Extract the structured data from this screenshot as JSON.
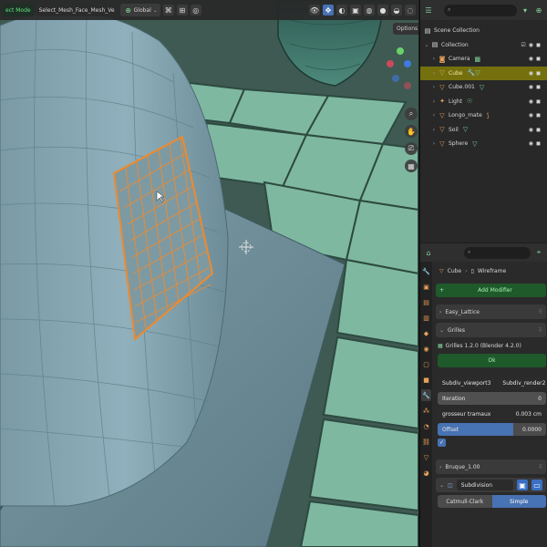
{
  "viewport": {
    "header": {
      "mode_label": "ect Mode",
      "menus": [
        "Select",
        "Mesh",
        "Face",
        "Mesh",
        "Ve"
      ],
      "menu_text": "Select_Mesh_Face_Mesh_Ve",
      "transform_label": "Global",
      "options_label": "Options"
    },
    "icons": {
      "gizmo": "axis-gizmo-icon",
      "zoom": "zoom-icon",
      "pan": "hand-icon",
      "camera": "camera-icon",
      "grid": "grid-icon"
    }
  },
  "outliner": {
    "search_placeholder": "",
    "items": [
      {
        "label": "Scene Collection",
        "icon": "scene-collection-icon",
        "indent": 0,
        "selected": false
      },
      {
        "label": "Collection",
        "icon": "collection-icon",
        "indent": 1,
        "selected": false
      },
      {
        "label": "Camera",
        "icon": "camera-object-icon",
        "indent": 2,
        "selected": false
      },
      {
        "label": "Cube",
        "icon": "mesh-object-icon",
        "indent": 2,
        "selected": true
      },
      {
        "label": "Cube.001",
        "icon": "mesh-object-icon",
        "indent": 2,
        "selected": false
      },
      {
        "label": "Light",
        "icon": "light-object-icon",
        "indent": 2,
        "selected": false
      },
      {
        "label": "Longo_mate",
        "icon": "mesh-object-icon",
        "indent": 2,
        "selected": false
      },
      {
        "label": "Soil",
        "icon": "mesh-object-icon",
        "indent": 2,
        "selected": false
      },
      {
        "label": "Sphere",
        "icon": "mesh-object-icon",
        "indent": 2,
        "selected": false
      }
    ]
  },
  "properties": {
    "breadcrumb": {
      "object": "Cube",
      "modifier": "Wireframe"
    },
    "add_modifier_label": "Add Modifier",
    "panels": {
      "first": "Easy_Lattice",
      "grilles": "Grilles",
      "last": "Bruque_1.00"
    },
    "grilles": {
      "node_label": "Grilles 1.2.0 (Blender 4.2.0)",
      "ok_label": "Ok",
      "subdiv_viewport_label": "Subdiv_viewport",
      "subdiv_viewport_value": "3",
      "subdiv_render_label": "Subdiv_render",
      "subdiv_render_value": "2",
      "iteration_label": "Iteration",
      "iteration_value": "0",
      "thickness_label": "grosseur tramaux",
      "thickness_value": "0.003 cm",
      "offset_label": "Offset",
      "offset_value": "0.0000",
      "offset_fraction": 0.7
    },
    "subdivision": {
      "label": "Subdivision",
      "option_left": "Catmull-Clark",
      "option_right": "Simple",
      "active": "Simple"
    },
    "colors": {
      "accent_blue": "#4772b3",
      "selected_row": "#75700e",
      "green_button": "#1f5a2b"
    }
  }
}
